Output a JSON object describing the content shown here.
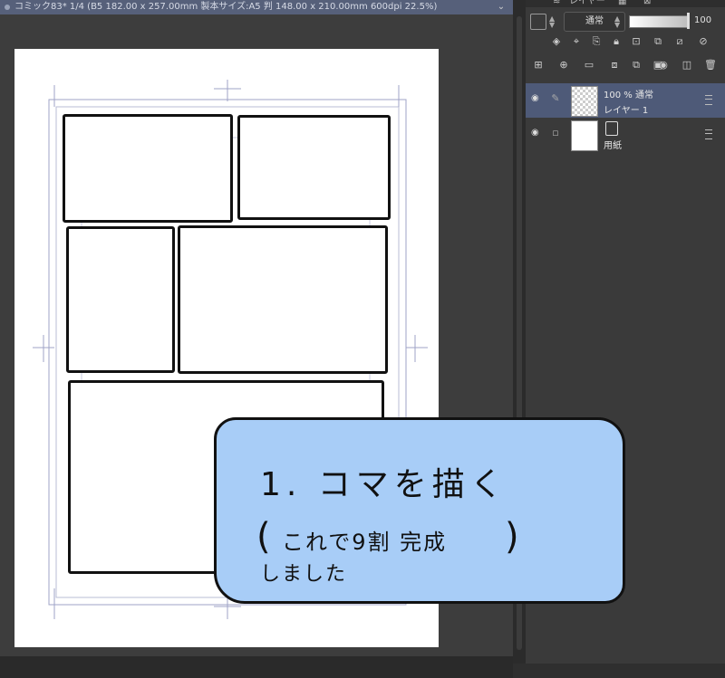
{
  "document": {
    "title": "コミック83* 1/4 (B5 182.00 x 257.00mm 製本サイズ:A5 判 148.00 x 210.00mm 600dpi 22.5%)",
    "chevron": "⌄"
  },
  "layer_panel": {
    "tab_label": "レイヤー",
    "blend_mode": "通常",
    "opacity": "100",
    "layers": [
      {
        "opacity_blend": "100 % 通常",
        "name": "レイヤー 1",
        "selected": true
      },
      {
        "name": "用紙",
        "selected": false
      }
    ]
  },
  "overlay_note": {
    "line1": "1. コマを描く",
    "line2": "これで9割 完成",
    "line3": "しました",
    "paren_open": "(",
    "paren_close": ")",
    "background": "#a8cdf7"
  },
  "colors": {
    "selected_layer": "#4e5a78",
    "title_bar": "#56607a"
  }
}
